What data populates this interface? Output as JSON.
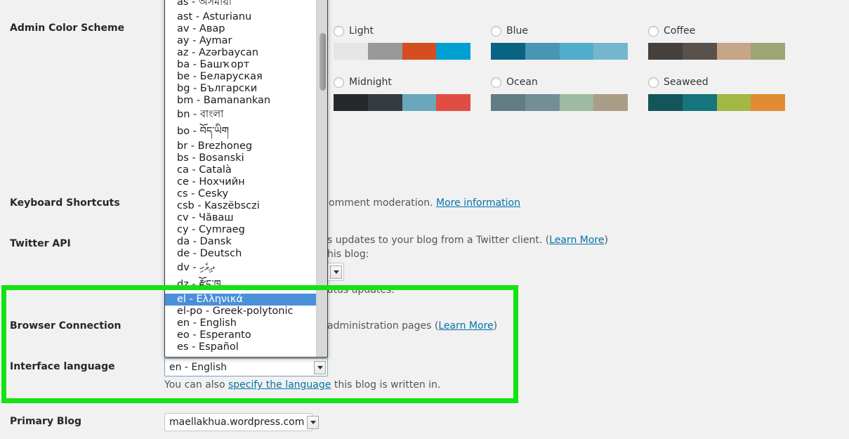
{
  "rows": {
    "admin_color_scheme": {
      "label": "Admin Color Scheme",
      "schemes": [
        {
          "name": "Light",
          "colors": [
            "#e5e5e5",
            "#999999",
            "#d54e21",
            "#00a0d2"
          ]
        },
        {
          "name": "Blue",
          "colors": [
            "#096484",
            "#4796b3",
            "#52accc",
            "#74B6CE"
          ]
        },
        {
          "name": "Coffee",
          "colors": [
            "#46403c",
            "#59524c",
            "#c7a589",
            "#9ea476"
          ]
        },
        {
          "name": "Midnight",
          "colors": [
            "#25282b",
            "#363b3f",
            "#69a8bb",
            "#e14d43"
          ]
        },
        {
          "name": "Ocean",
          "colors": [
            "#627c83",
            "#738e96",
            "#9ebaa0",
            "#aa9d88"
          ]
        },
        {
          "name": "Seaweed",
          "colors": [
            "#12565b",
            "#15747c",
            "#a3b745",
            "#e28b36"
          ]
        }
      ]
    },
    "keyboard_shortcuts": {
      "label": "Keyboard Shortcuts",
      "text_visible": "omment moderation.",
      "link": "More information"
    },
    "twitter_api": {
      "label": "Twitter API",
      "line1_visible": "s updates to your blog from a Twitter client. (",
      "line1_link": "Learn More",
      "line1_tail": ")",
      "line2_visible": "his blog:",
      "select_value": "/",
      "line3_visible": "atus updates."
    },
    "browser_connection": {
      "label": "Browser Connection",
      "text_visible": " administration pages (",
      "link": "Learn More",
      "tail": ")"
    },
    "interface_language": {
      "label": "Interface language",
      "select_value": "en - English",
      "desc_before": "You can also ",
      "desc_link": "specify the language",
      "desc_after": " this blog is written in."
    },
    "primary_blog": {
      "label": "Primary Blog",
      "select_value": "maellakhua.wordpress.com"
    }
  },
  "language_dropdown": {
    "selected": "el - Ελληνικά",
    "options": [
      {
        "label": "as - অসমীয়া",
        "tall": true
      },
      {
        "label": "ast - Asturianu"
      },
      {
        "label": "av - Авар"
      },
      {
        "label": "ay - Aymar"
      },
      {
        "label": "az - Azərbaycan"
      },
      {
        "label": "ba - Башҡорт"
      },
      {
        "label": "be - Беларуская"
      },
      {
        "label": "bg - Български"
      },
      {
        "label": "bm - Bamanankan"
      },
      {
        "label": "bn - বাংলা",
        "tall": true
      },
      {
        "label": "bo - བོད་ཡིག",
        "tall": true
      },
      {
        "label": "br - Brezhoneg"
      },
      {
        "label": "bs - Bosanski"
      },
      {
        "label": "ca - Català"
      },
      {
        "label": "ce - Нохчийн"
      },
      {
        "label": "cs - Česky"
      },
      {
        "label": "csb - Kaszëbsczi"
      },
      {
        "label": "cv - Чăваш"
      },
      {
        "label": "cy - Cymraeg"
      },
      {
        "label": "da - Dansk"
      },
      {
        "label": "de - Deutsch"
      },
      {
        "label": "dv - ދިވެހި",
        "tall": true
      },
      {
        "label": "dz - རྫོང་ཁ",
        "tall": true
      },
      {
        "label": "el - Ελληνικά",
        "selected": true
      },
      {
        "label": "el-po - Greek-polytonic"
      },
      {
        "label": "en - English"
      },
      {
        "label": "eo - Esperanto"
      },
      {
        "label": "es - Español"
      }
    ]
  },
  "colors": {
    "highlight_box": "#14e214",
    "selection_blue": "#4a90d9",
    "link": "#0073aa",
    "page_background": "#f1f1f1"
  }
}
